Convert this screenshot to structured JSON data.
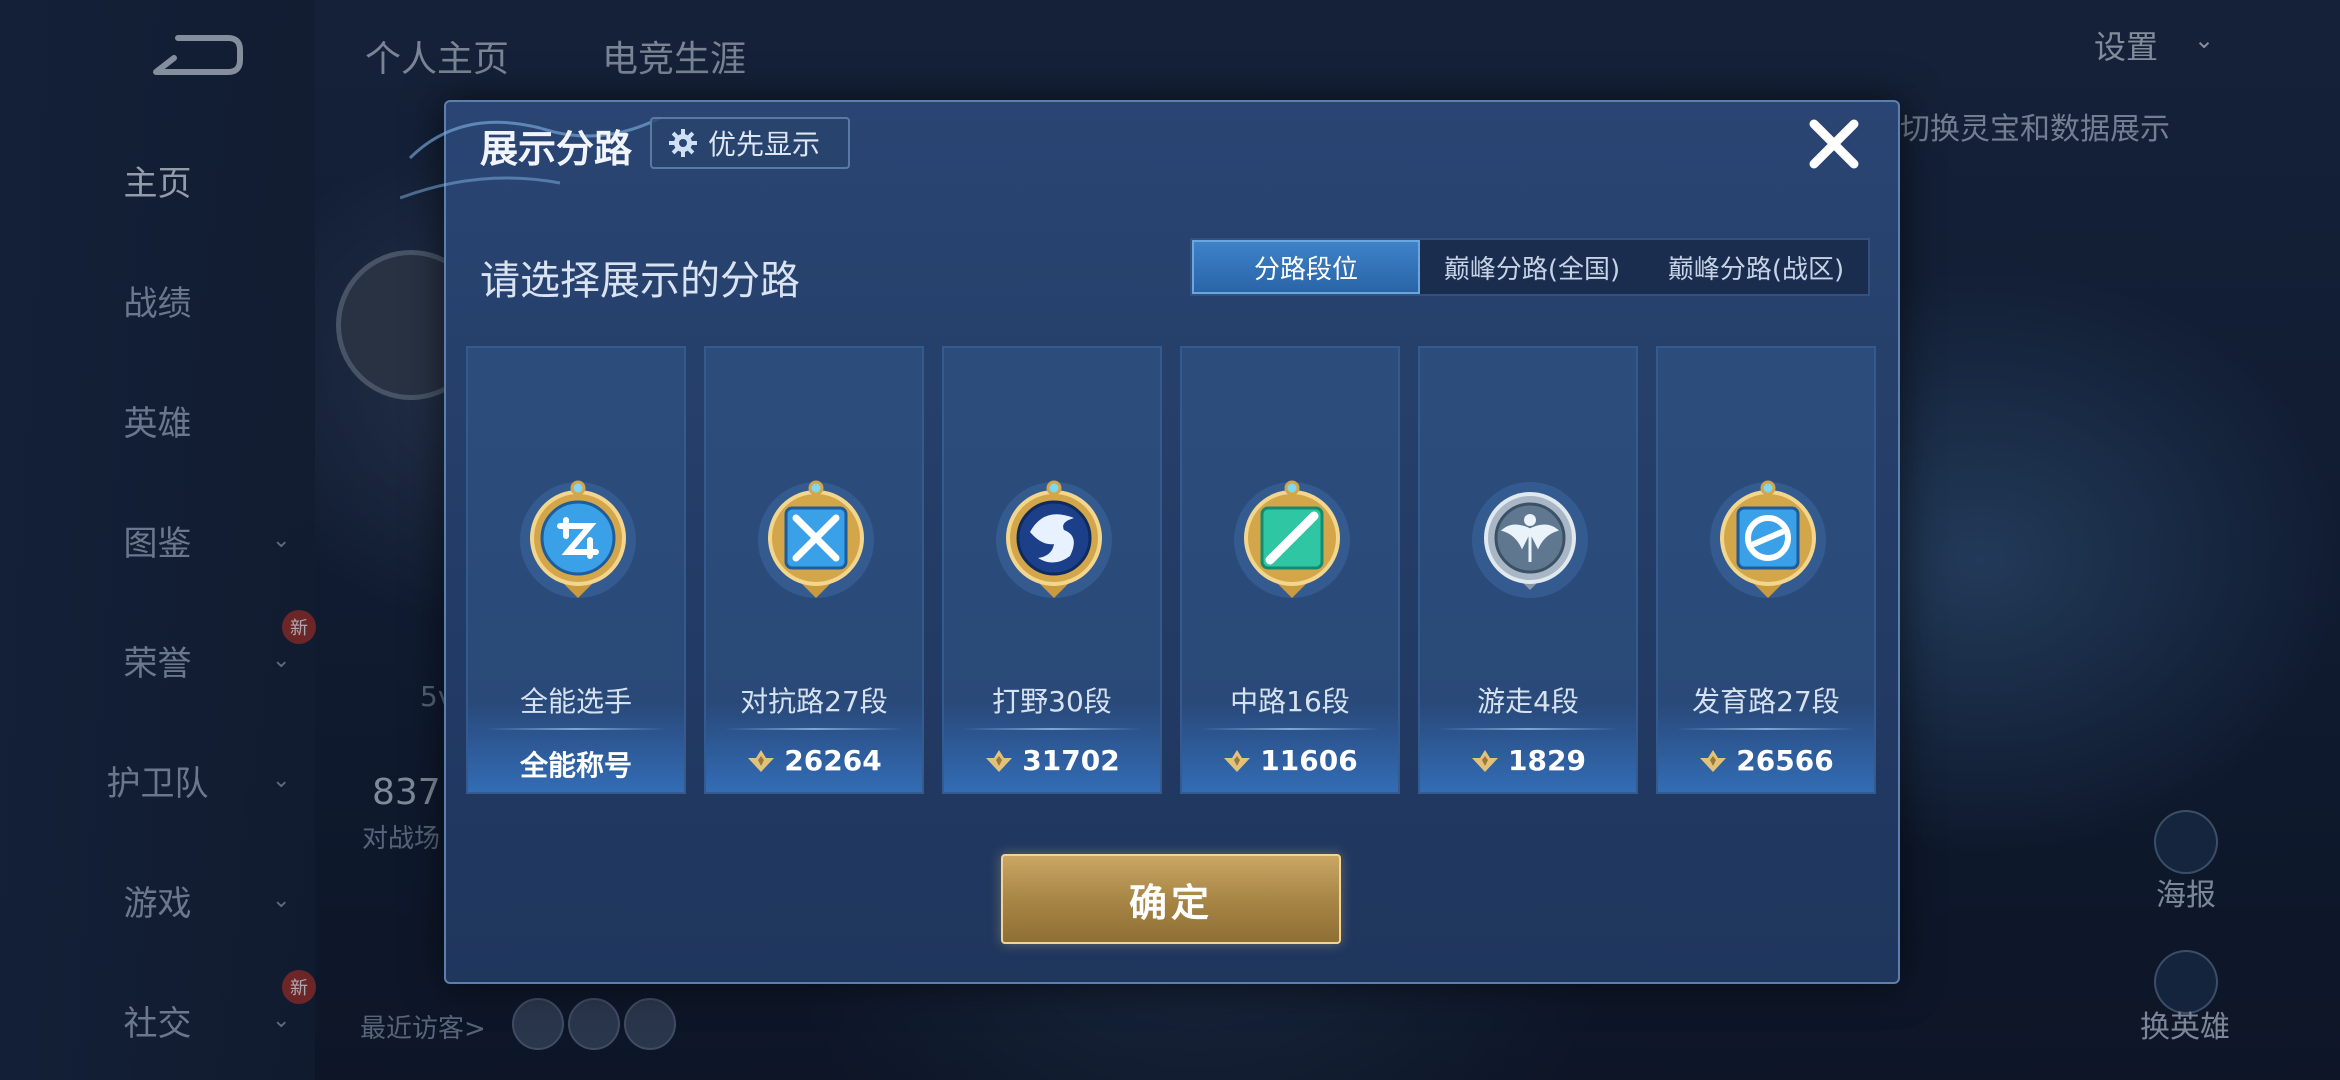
{
  "background": {
    "top_tabs": [
      "个人主页",
      "电竞生涯"
    ],
    "settings_label": "设置",
    "right_hint": "切换灵宝和数据展示",
    "sidebar": {
      "items": [
        {
          "label": "主页",
          "chevron": false,
          "new": false
        },
        {
          "label": "战绩",
          "chevron": false,
          "new": false
        },
        {
          "label": "英雄",
          "chevron": false,
          "new": false
        },
        {
          "label": "图鉴",
          "chevron": true,
          "new": false
        },
        {
          "label": "荣誉",
          "chevron": true,
          "new": true
        },
        {
          "label": "护卫队",
          "chevron": true,
          "new": false
        },
        {
          "label": "游戏",
          "chevron": true,
          "new": false
        },
        {
          "label": "社交",
          "chevron": true,
          "new": true
        }
      ],
      "new_badge": "新"
    },
    "left_number": "837",
    "left_sub": "对战场",
    "left_5v": "5v",
    "recent_visitors": "最近访客>",
    "right_actions": [
      "海报",
      "换英雄"
    ]
  },
  "dialog": {
    "title": "展示分路",
    "priority_button": "优先显示",
    "subtitle": "请选择展示的分路",
    "tabs": [
      {
        "label": "分路段位",
        "active": true
      },
      {
        "label": "巅峰分路(全国)",
        "active": false
      },
      {
        "label": "巅峰分路(战区)",
        "active": false
      }
    ],
    "cards": [
      {
        "lane": "全能选手",
        "score": "全能称号",
        "score_icon": false,
        "emblem": "all-round-emblem-icon",
        "emblem_color": "#3aa0e8"
      },
      {
        "lane": "对抗路27段",
        "score": "26264",
        "score_icon": true,
        "emblem": "clash-lane-emblem-icon",
        "emblem_color": "#3aa0e8"
      },
      {
        "lane": "打野30段",
        "score": "31702",
        "score_icon": true,
        "emblem": "jungle-emblem-icon",
        "emblem_color": "#2b78d8"
      },
      {
        "lane": "中路16段",
        "score": "11606",
        "score_icon": true,
        "emblem": "mid-lane-emblem-icon",
        "emblem_color": "#2fc6a4"
      },
      {
        "lane": "游走4段",
        "score": "1829",
        "score_icon": true,
        "emblem": "roam-emblem-icon",
        "emblem_color": "#8aa4bc"
      },
      {
        "lane": "发育路27段",
        "score": "26566",
        "score_icon": true,
        "emblem": "farm-lane-emblem-icon",
        "emblem_color": "#3aa0e8"
      }
    ],
    "confirm_button": "确定"
  }
}
